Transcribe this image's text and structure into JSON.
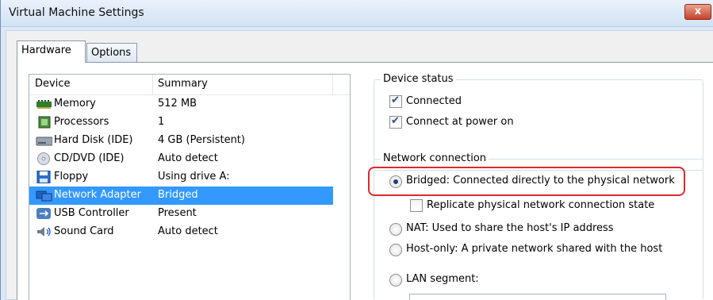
{
  "window": {
    "title": "Virtual Machine Settings",
    "close_label": "x"
  },
  "tabs": [
    {
      "label": "Hardware",
      "active": true
    },
    {
      "label": "Options",
      "active": false
    }
  ],
  "device_list": {
    "columns": [
      "Device",
      "Summary"
    ],
    "rows": [
      {
        "icon": "memory-icon",
        "name": "Memory",
        "summary": "512 MB"
      },
      {
        "icon": "processor-icon",
        "name": "Processors",
        "summary": "1"
      },
      {
        "icon": "hard-disk-icon",
        "name": "Hard Disk (IDE)",
        "summary": "4 GB (Persistent)"
      },
      {
        "icon": "cd-dvd-icon",
        "name": "CD/DVD (IDE)",
        "summary": "Auto detect"
      },
      {
        "icon": "floppy-icon",
        "name": "Floppy",
        "summary": "Using drive A:"
      },
      {
        "icon": "network-adapter-icon",
        "name": "Network Adapter",
        "summary": "Bridged",
        "selected": true
      },
      {
        "icon": "usb-icon",
        "name": "USB Controller",
        "summary": "Present"
      },
      {
        "icon": "sound-card-icon",
        "name": "Sound Card",
        "summary": "Auto detect"
      }
    ]
  },
  "device_status": {
    "label": "Device status",
    "connected": {
      "label": "Connected",
      "checked": true
    },
    "connect_at_power_on": {
      "label": "Connect at power on",
      "checked": true
    }
  },
  "network_connection": {
    "label": "Network connection",
    "bridged": {
      "label": "Bridged: Connected directly to the physical network",
      "selected": true
    },
    "replicate": {
      "label": "Replicate physical network connection state",
      "checked": false
    },
    "nat": {
      "label": "NAT: Used to share the host's IP address",
      "selected": false
    },
    "host_only": {
      "label": "Host-only: A private network shared with the host",
      "selected": false
    },
    "lan_segment": {
      "label": "LAN segment:",
      "selected": false
    }
  },
  "colors": {
    "selection": "#3399ff",
    "highlight": "#e0282e",
    "title_bg": "#dbe8f7"
  }
}
